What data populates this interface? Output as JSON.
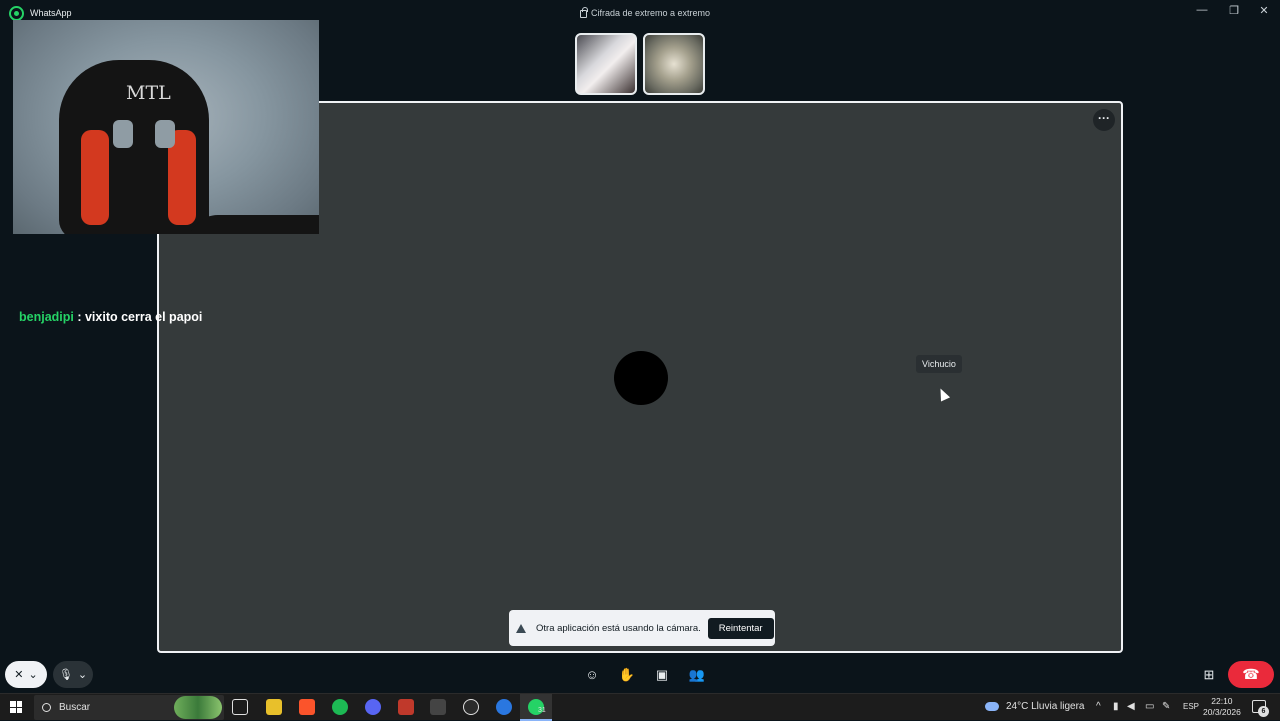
{
  "app": {
    "title": "WhatsApp",
    "encryption_text": "Cifrada de extremo a extremo",
    "window_controls": {
      "minimize": "—",
      "restore": "❐",
      "close": "✕"
    }
  },
  "call": {
    "participant_tooltip": "Vichucio",
    "more_label": "···",
    "camera_alert": {
      "message": "Otra aplicación está usando la cámara.",
      "retry_label": "Reintentar"
    }
  },
  "chat_overlay": {
    "user": "benjadipi",
    "message": " : vixito cerra el papoi"
  },
  "self_preview": {
    "chair_logo": "MTL"
  },
  "controls": {
    "camera_icon": "✕",
    "camera_chevron": "⌄",
    "mic_icon": "🎙",
    "mic_chevron": "⌄",
    "emoji_icon": "☺",
    "raise_hand_icon": "✋",
    "share_screen_icon": "▣",
    "participants_icon": "👥",
    "layout_icon": "⊞",
    "end_call_icon": "☎"
  },
  "taskbar": {
    "search_placeholder": "Buscar",
    "weather": "24°C  Lluvia ligera",
    "language": "ESP",
    "time": "22:10",
    "date": "20/3/2026",
    "notification_count": "6",
    "whatsapp_badge": "31",
    "pinned_colors": [
      "#e8c02b",
      "#fb542b",
      "#1db954",
      "#5865f2",
      "#c0392b",
      "#444444",
      "#2b2b2b",
      "#2a77e0",
      "#25d366"
    ]
  }
}
